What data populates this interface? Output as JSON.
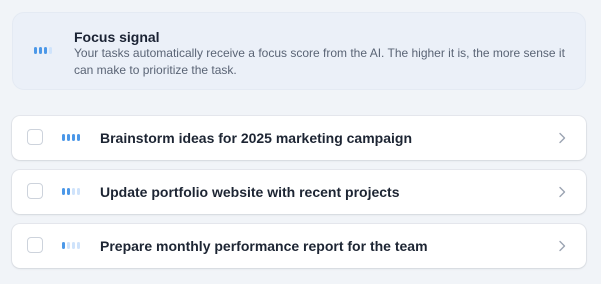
{
  "info": {
    "title": "Focus signal",
    "description": "Your tasks automatically receive a focus score from the AI. The higher it is, the more sense it can make to prioritize the task.",
    "signal_icon": "signal-bars-icon",
    "signal_level": 3
  },
  "colors": {
    "signal_active": "#4c98e8",
    "signal_inactive": "#cfe3fb",
    "card_background": "#ebf0f8",
    "page_background": "#f1f4f8"
  },
  "tasks": [
    {
      "title": "Brainstorm ideas for 2025 marketing campaign",
      "focus_level": 4,
      "checked": false
    },
    {
      "title": "Update portfolio website with recent projects",
      "focus_level": 2,
      "checked": false
    },
    {
      "title": "Prepare monthly performance report for the team",
      "focus_level": 1,
      "checked": false
    }
  ],
  "icons": {
    "checkbox": "checkbox-icon",
    "chevron": "chevron-right-icon"
  }
}
